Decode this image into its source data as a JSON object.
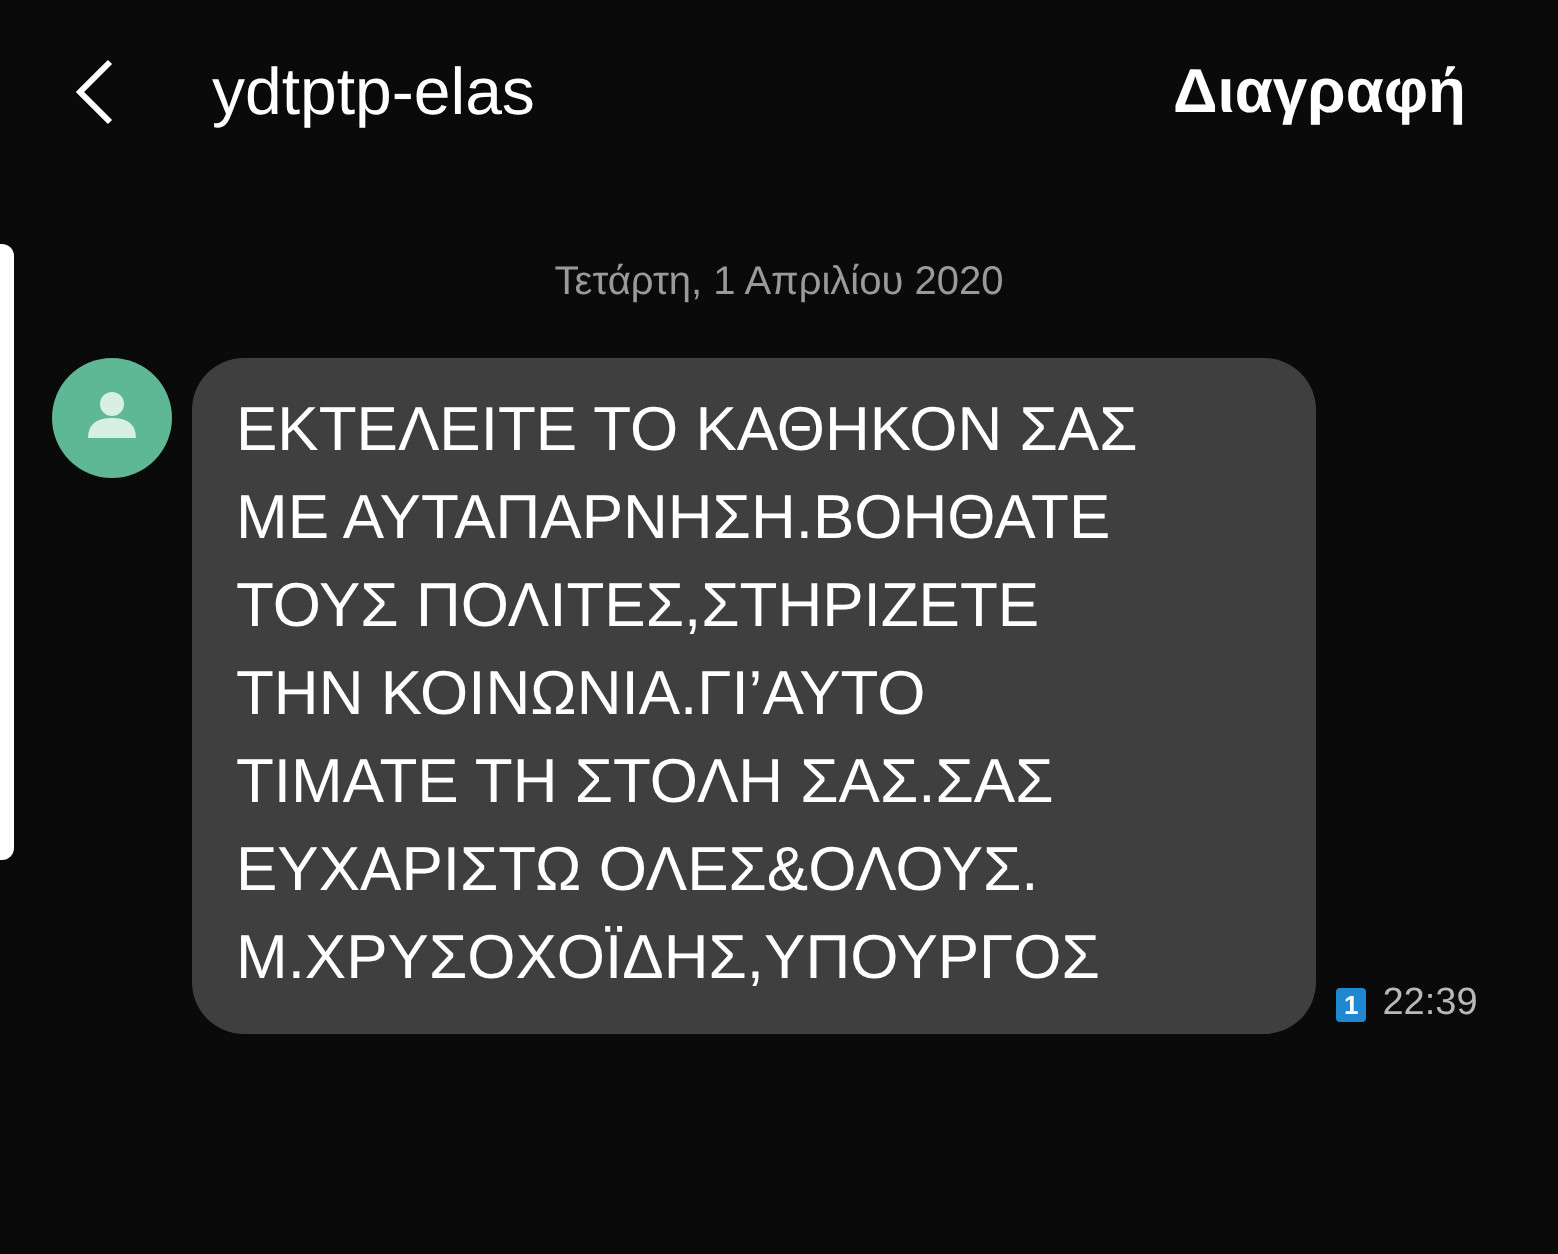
{
  "header": {
    "title": "ydtptp-elas",
    "action": "Διαγραφή"
  },
  "date_divider": "Τετάρτη, 1 Απριλίου 2020",
  "messages": [
    {
      "text": "ΕΚΤΕΛΕΙΤΕ ΤΟ ΚΑΘΗΚΟΝ ΣΑΣ\nΜΕ ΑΥΤΑΠΑΡΝΗΣΗ.ΒΟΗΘΑΤΕ\nΤΟΥΣ ΠΟΛΙΤΕΣ,ΣΤΗΡΙΖΕΤΕ\nΤΗΝ ΚΟΙΝΩΝΙΑ.ΓΙ’ΑΥΤΟ\nΤΙΜΑΤΕ ΤΗ ΣΤΟΛΗ ΣΑΣ.ΣΑΣ\nΕΥΧΑΡΙΣΤΩ ΟΛΕΣ&ΟΛΟΥΣ.\nΜ.ΧΡΥΣΟΧΟΪΔΗΣ,ΥΠΟΥΡΓΟΣ",
      "sim": "1",
      "time": "22:39"
    }
  ]
}
